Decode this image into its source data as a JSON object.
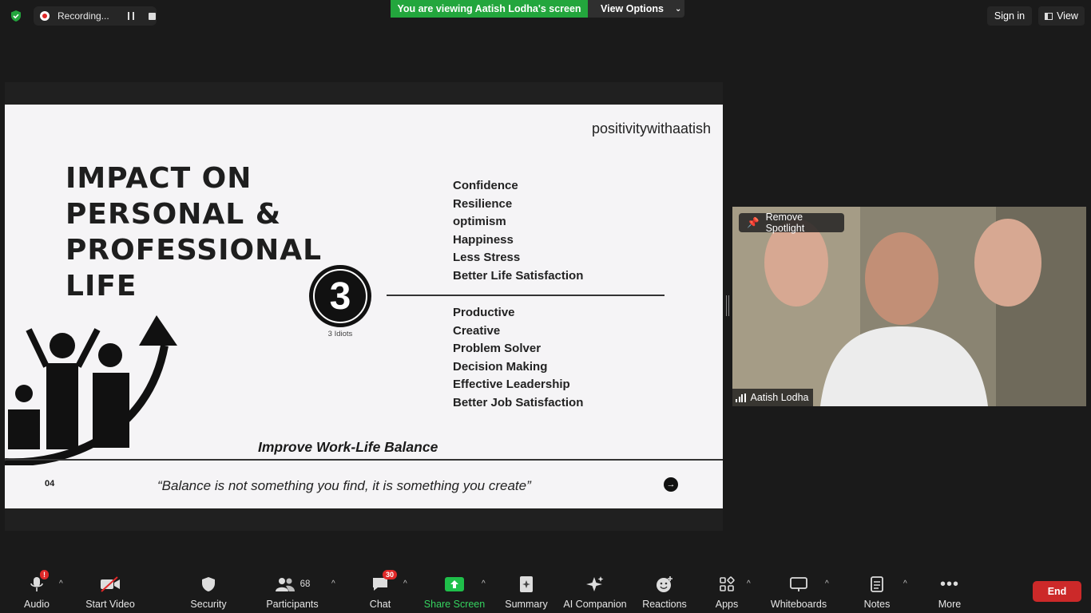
{
  "top_bar": {
    "recording_label": "Recording...",
    "viewing_banner": "You are viewing Aatish Lodha's screen",
    "view_options_label": "View Options",
    "sign_in_label": "Sign in",
    "view_label": "View"
  },
  "slide": {
    "brand": "positivitywithaatish",
    "title_lines": [
      "IMPACT ON",
      "PERSONAL &",
      "PROFESSIONAL",
      "LIFE"
    ],
    "badge_number": "3",
    "badge_caption": "3 Idiots",
    "personal_list": [
      "Confidence",
      "Resilience",
      "optimism",
      "Happiness",
      "Less Stress",
      "Better Life Satisfaction"
    ],
    "professional_list": [
      "Productive",
      "Creative",
      "Problem Solver",
      "Decision Making",
      "Effective Leadership",
      "Better Job Satisfaction"
    ],
    "balance_title": "Improve Work-Life Balance",
    "page_number": "04",
    "quote": "“Balance is not something you find, it is something you create”"
  },
  "video": {
    "remove_spotlight_label": "Remove Spotlight",
    "participant_name": "Aatish Lodha"
  },
  "toolbar": {
    "audio_label": "Audio",
    "start_video_label": "Start Video",
    "security_label": "Security",
    "participants_label": "Participants",
    "participants_count": "68",
    "chat_label": "Chat",
    "chat_badge": "30",
    "share_screen_label": "Share Screen",
    "summary_label": "Summary",
    "ai_companion_label": "AI Companion",
    "reactions_label": "Reactions",
    "apps_label": "Apps",
    "whiteboards_label": "Whiteboards",
    "notes_label": "Notes",
    "more_label": "More",
    "end_label": "End"
  },
  "colors": {
    "background": "#1a1a1a",
    "recording_red": "#e02828",
    "banner_green": "#23a63d",
    "share_green": "#1fbf4a",
    "end_red": "#cc2929",
    "slide_bg": "#f5f4f6"
  }
}
